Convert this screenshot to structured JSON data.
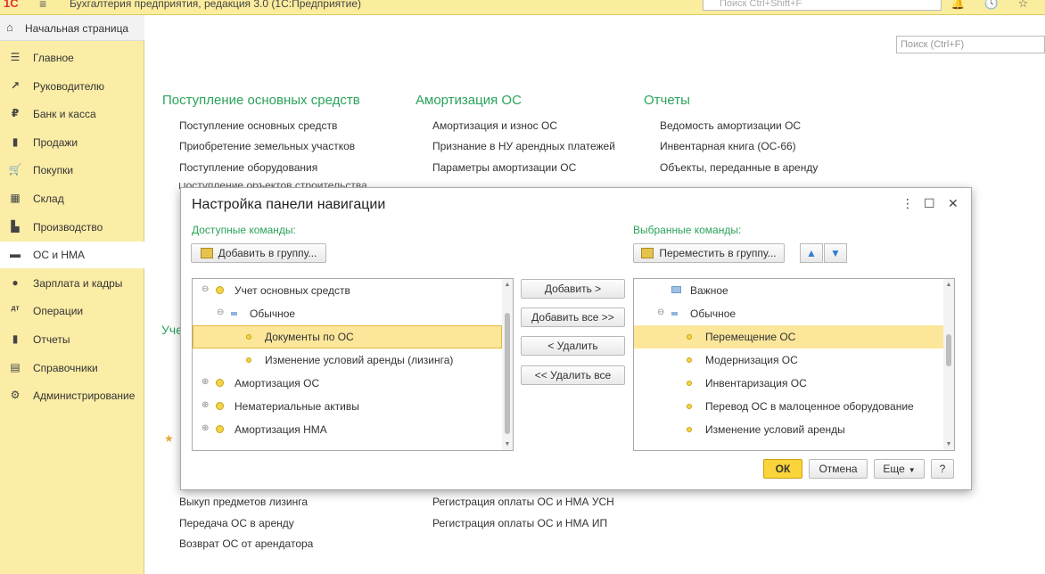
{
  "window": {
    "app_title": "Бухгалтерия предприятия, редакция 3.0  (1С:Предприятие)",
    "search_placeholder": "Поиск Ctrl+Shift+F"
  },
  "sidebar": {
    "home_label": "Начальная страница",
    "items": [
      {
        "label": "Главное",
        "icon": "menu-icon"
      },
      {
        "label": "Руководителю",
        "icon": "trend-icon"
      },
      {
        "label": "Банк и касса",
        "icon": "ruble-icon"
      },
      {
        "label": "Продажи",
        "icon": "bag-icon"
      },
      {
        "label": "Покупки",
        "icon": "cart-icon"
      },
      {
        "label": "Склад",
        "icon": "warehouse-icon"
      },
      {
        "label": "Производство",
        "icon": "factory-icon"
      },
      {
        "label": "ОС и НМА",
        "icon": "truck-icon",
        "active": true
      },
      {
        "label": "Зарплата и кадры",
        "icon": "person-icon"
      },
      {
        "label": "Операции",
        "icon": "operations-icon"
      },
      {
        "label": "Отчеты",
        "icon": "chart-icon"
      },
      {
        "label": "Справочники",
        "icon": "book-icon"
      },
      {
        "label": "Администрирование",
        "icon": "gear-icon"
      }
    ]
  },
  "main": {
    "search_placeholder": "Поиск (Ctrl+F)",
    "columns": [
      {
        "heading": "Поступление основных средств",
        "links": [
          "Поступление основных средств",
          "Приобретение земельных участков",
          "Поступление оборудования",
          "Поступление объектов строительства"
        ]
      },
      {
        "heading": "Амортизация ОС",
        "links": [
          "Амортизация и износ ОС",
          "Признание в НУ арендных платежей",
          "Параметры амортизации ОС"
        ]
      },
      {
        "heading": "Отчеты",
        "links": [
          "Ведомость амортизации ОС",
          "Инвентарная книга (ОС-66)",
          "Объекты, переданные в аренду"
        ]
      }
    ],
    "partial_heading": "Уче",
    "bottom_links_left": [
      "Выкуп предметов лизинга",
      "Передача ОС в аренду",
      "Возврат ОС от арендатора"
    ],
    "bottom_links_right": [
      "Регистрация оплаты ОС и НМА УСН",
      "Регистрация оплаты ОС и НМА ИП"
    ]
  },
  "dialog": {
    "title": "Настройка панели навигации",
    "available_label": "Доступные команды:",
    "selected_label": "Выбранные команды:",
    "add_to_group": "Добавить в группу...",
    "move_to_group": "Переместить в группу...",
    "buttons": {
      "add": "Добавить >",
      "add_all": "Добавить все >>",
      "remove": "< Удалить",
      "remove_all": "<< Удалить все"
    },
    "available": [
      {
        "label": "Учет основных средств",
        "level": 0,
        "toggle": "⊖",
        "marker": "dot"
      },
      {
        "label": "Обычное",
        "level": 1,
        "toggle": "⊖",
        "marker": "dash"
      },
      {
        "label": "Документы по ОС",
        "level": 2,
        "marker": "dot-small",
        "state": "focus"
      },
      {
        "label": "Изменение условий аренды (лизинга)",
        "level": 2,
        "marker": "dot-small"
      },
      {
        "label": "Амортизация ОС",
        "level": 0,
        "toggle": "⊕",
        "marker": "dot"
      },
      {
        "label": "Нематериальные активы",
        "level": 0,
        "toggle": "⊕",
        "marker": "dot"
      },
      {
        "label": "Амортизация НМА",
        "level": 0,
        "toggle": "⊕",
        "marker": "dot"
      }
    ],
    "selected": [
      {
        "label": "Важное",
        "level": 0,
        "marker": "rect"
      },
      {
        "label": "Обычное",
        "level": 0,
        "toggle": "⊖",
        "marker": "dash"
      },
      {
        "label": "Перемещение ОС",
        "level": 1,
        "marker": "dot-small",
        "state": "sel"
      },
      {
        "label": "Модернизация ОС",
        "level": 1,
        "marker": "dot-small"
      },
      {
        "label": "Инвентаризация ОС",
        "level": 1,
        "marker": "dot-small"
      },
      {
        "label": "Перевод ОС в малоценное оборудование",
        "level": 1,
        "marker": "dot-small"
      },
      {
        "label": "Изменение условий аренды",
        "level": 1,
        "marker": "dot-small"
      }
    ],
    "ok": "ОК",
    "cancel": "Отмена",
    "more": "Еще",
    "help": "?"
  }
}
